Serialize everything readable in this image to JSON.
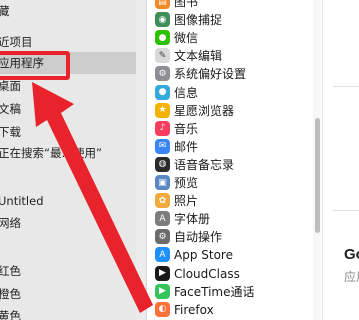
{
  "sidebar": {
    "items": [
      {
        "label": "藏",
        "state": "normal"
      },
      {
        "label": "近项目",
        "state": "normal"
      },
      {
        "label": "应用程序",
        "state": "selected"
      },
      {
        "label": "桌面",
        "state": "normal"
      },
      {
        "label": "文稿",
        "state": "normal"
      },
      {
        "label": "下载",
        "state": "normal"
      },
      {
        "label": "正在搜索“最…使用”",
        "state": "normal"
      },
      {
        "label": "",
        "state": "normal"
      },
      {
        "label": "Untitled",
        "state": "normal"
      },
      {
        "label": "网络",
        "state": "normal"
      },
      {
        "label": "",
        "state": "normal"
      },
      {
        "label": "红色",
        "state": "normal"
      },
      {
        "label": "橙色",
        "state": "normal"
      },
      {
        "label": "黄色",
        "state": "normal"
      }
    ]
  },
  "apps": [
    {
      "name": "图书",
      "icon": "book-icon",
      "color": "#f08a24"
    },
    {
      "name": "图像捕捉",
      "icon": "camera-icon",
      "color": "#3f8f5a"
    },
    {
      "name": "微信",
      "icon": "wechat-icon",
      "color": "#2dc100"
    },
    {
      "name": "文本编辑",
      "icon": "textedit-icon",
      "color": "#d9d9d9"
    },
    {
      "name": "系统偏好设置",
      "icon": "gear-icon",
      "color": "#8e8e93"
    },
    {
      "name": "信息",
      "icon": "message-icon",
      "color": "#34aadc"
    },
    {
      "name": "星愿浏览器",
      "icon": "star-browser-icon",
      "color": "#f5b301"
    },
    {
      "name": "音乐",
      "icon": "music-icon",
      "color": "#fa3d5f"
    },
    {
      "name": "邮件",
      "icon": "mail-icon",
      "color": "#3a86f7"
    },
    {
      "name": "语音备忘录",
      "icon": "voice-memo-icon",
      "color": "#2b2b2b"
    },
    {
      "name": "预览",
      "icon": "preview-icon",
      "color": "#5a88c4"
    },
    {
      "name": "照片",
      "icon": "photos-icon",
      "color": "#f2a93b"
    },
    {
      "name": "字体册",
      "icon": "fontbook-icon",
      "color": "#7d7d7d"
    },
    {
      "name": "自动操作",
      "icon": "automator-icon",
      "color": "#6c6c6c"
    },
    {
      "name": "App Store",
      "icon": "appstore-icon",
      "color": "#1e90ff"
    },
    {
      "name": "CloudClass",
      "icon": "cloudclass-icon",
      "color": "#1a1a1a"
    },
    {
      "name": "FaceTime通话",
      "icon": "facetime-icon",
      "color": "#36c55a"
    },
    {
      "name": "Firefox",
      "icon": "firefox-icon",
      "color": "#ff7139"
    }
  ],
  "preview": {
    "title": "Go",
    "subtitle": "应用"
  },
  "annotation": {
    "color": "#e8232b"
  }
}
